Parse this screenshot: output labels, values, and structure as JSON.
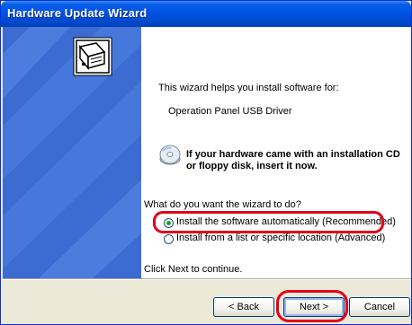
{
  "window": {
    "title": "Hardware Update Wizard"
  },
  "content": {
    "intro": "This wizard helps you install software for:",
    "device": "Operation Panel USB Driver",
    "cd_notice_line1": "If your hardware came with an installation CD",
    "cd_notice_line2": "or floppy disk, insert it now.",
    "question": "What do you want the wizard to do?",
    "options": [
      {
        "label": "Install the software automatically (Recommended)",
        "selected": true
      },
      {
        "label": "Install from a list or specific location (Advanced)",
        "selected": false
      }
    ],
    "footer_hint": "Click Next to continue."
  },
  "buttons": {
    "back": "< Back",
    "next": "Next >",
    "cancel": "Cancel"
  },
  "colors": {
    "titlebar": "#0054e3",
    "banner": "#3c6bd2",
    "highlight": "#e2001a",
    "radio_dot": "#21a121"
  },
  "icons": {
    "banner": "hardware-card-icon",
    "cd": "cd-icon"
  }
}
